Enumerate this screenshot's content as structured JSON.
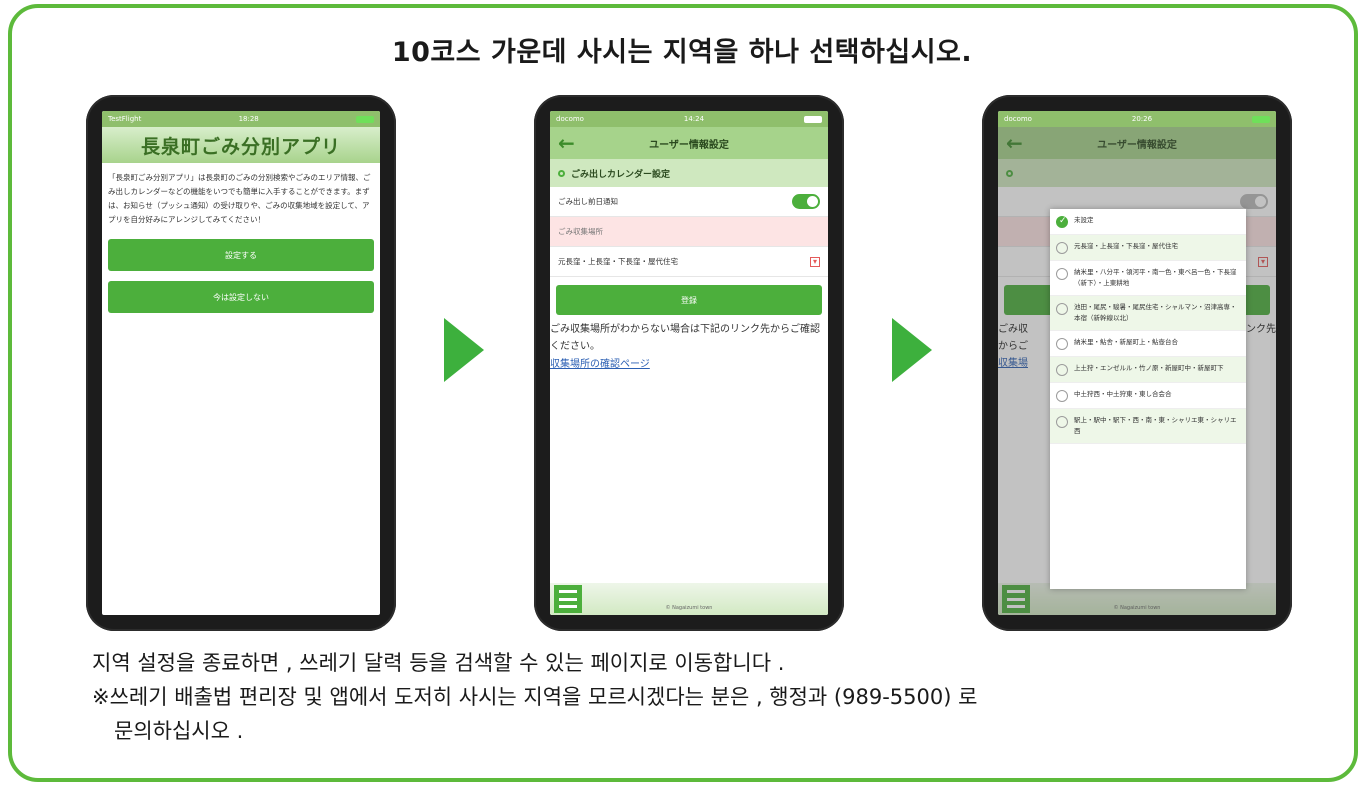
{
  "headline": "10코스 가운데 사시는 지역을 하나 선택하십시오.",
  "colors": {
    "accent": "#5dba3b",
    "button": "#4caf3c",
    "arrow": "#3db03d"
  },
  "phone1": {
    "status_left": "TestFlight",
    "status_time": "18:28",
    "app_title": "長泉町ごみ分別アプリ",
    "intro": "「長泉町ごみ分別アプリ」は長泉町のごみの分別検索やごみのエリア情報、ごみ出しカレンダーなどの機能をいつでも簡単に入手することができます。まずは、お知らせ（プッシュ通知）の受け取りや、ごみの収集地域を設定して、アプリを自分好みにアレンジしてみてください！",
    "btn_setup": "設定する",
    "btn_skip": "今は設定しない"
  },
  "phone2": {
    "status_left": "docomo",
    "status_time": "14:24",
    "screen_title": "ユーザー情報設定",
    "section_title": "ごみ出しカレンダー設定",
    "row_notify": "ごみ出し前日通知",
    "row_area_label": "ごみ収集場所",
    "row_area_value": "元長窪・上長窪・下長窪・屋代住宅",
    "btn_register": "登録",
    "note": "ごみ収集場所がわからない場合は下記のリンク先からご確認ください。",
    "link": "収集場所の確認ページ",
    "copyright": "© Nagaizumi town"
  },
  "phone3": {
    "status_left": "docomo",
    "status_time": "20:26",
    "screen_title": "ユーザー情報設定",
    "options": [
      "未設定",
      "元長窪・上長窪・下長窪・屋代住宅",
      "納米里・八分平・領河平・南一色・東ベ呂一色・下長窪（新下）・上東耕地",
      "池田・尾尻・駿暑・尾尻住宅・シャルマン・沼津高専・本宿（新幹線以北）",
      "納米里・鮎舎・新屋町上・鮎壺台合",
      "上土狩・エンゼルル・竹ノ原・新屋町中・新屋町下",
      "中土狩西・中土狩東・東し合会合",
      "駅上・駅中・駅下・西・南・東・シャリエ東・シャリエ西"
    ],
    "bg_left_1": "ごみ収",
    "bg_left_2": "からご",
    "bg_left_3": "収集場",
    "bg_right": "ンク先",
    "copyright": "© Nagaizumi town"
  },
  "bottom": {
    "line1": "지역 설정을 종료하면 , 쓰레기 달력 등을 검색할 수 있는 페이지로 이동합니다 .",
    "line2": "※쓰레기 배출법 편리장 및 앱에서 도저히 사시는 지역을 모르시겠다는 분은 , 행정과 (989-5500) 로",
    "line3": "문의하십시오 ."
  }
}
